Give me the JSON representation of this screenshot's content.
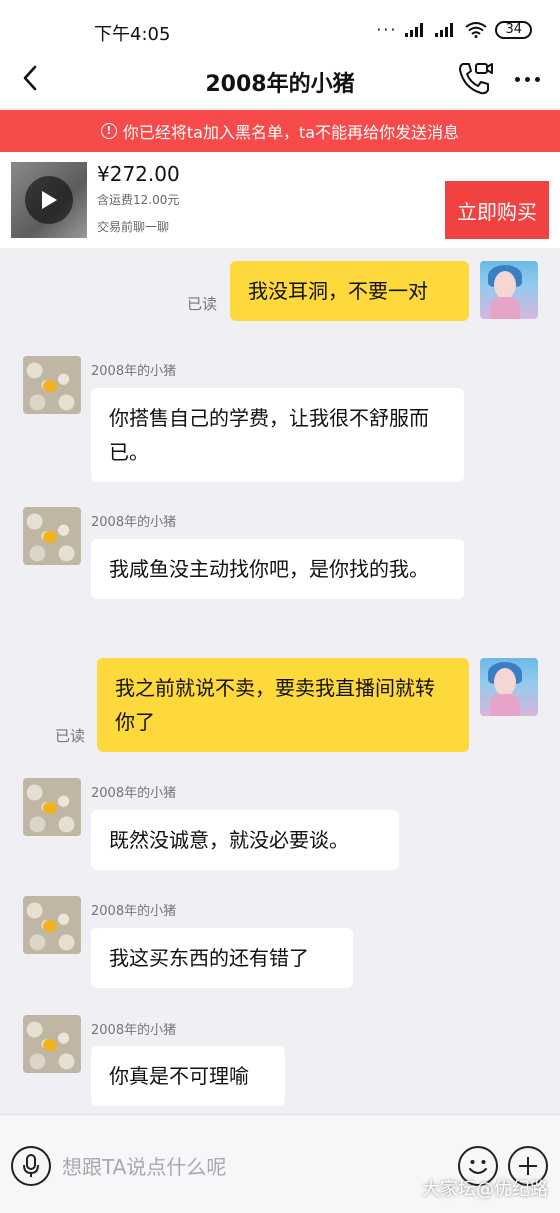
{
  "status_bar": {
    "time": "下午4:05",
    "signal_dots": "···",
    "battery": "34"
  },
  "header": {
    "title": "2008年的小猪"
  },
  "banner": {
    "text": "你已经将ta加入黑名单，ta不能再给你发送消息",
    "color": "#f74a4a"
  },
  "product": {
    "price": "¥272.00",
    "shipping": "含运费12.00元",
    "note": "交易前聊一聊",
    "buy_label": "立即购买"
  },
  "other_name": "2008年的小猪",
  "read_label": "已读",
  "messages": [
    {
      "from": "me",
      "text": "我没耳洞，不要一对",
      "read": true
    },
    {
      "from": "other",
      "text": "你搭售自己的学费，让我很不舒服而已。"
    },
    {
      "from": "other",
      "text": "我咸鱼没主动找你吧，是你找的我。"
    },
    {
      "from": "me",
      "text": "我之前就说不卖，要卖我直播间就转你了",
      "read": true
    },
    {
      "from": "other",
      "text": "既然没诚意，就没必要谈。"
    },
    {
      "from": "other",
      "text": "我这买东西的还有错了"
    },
    {
      "from": "other",
      "text": "你真是不可理喻"
    }
  ],
  "composer": {
    "placeholder": "想跟TA说点什么呢"
  },
  "watermark": "大家坛@优纪路",
  "colors": {
    "my_bubble": "#fed93b",
    "buy_button": "#f24141"
  }
}
